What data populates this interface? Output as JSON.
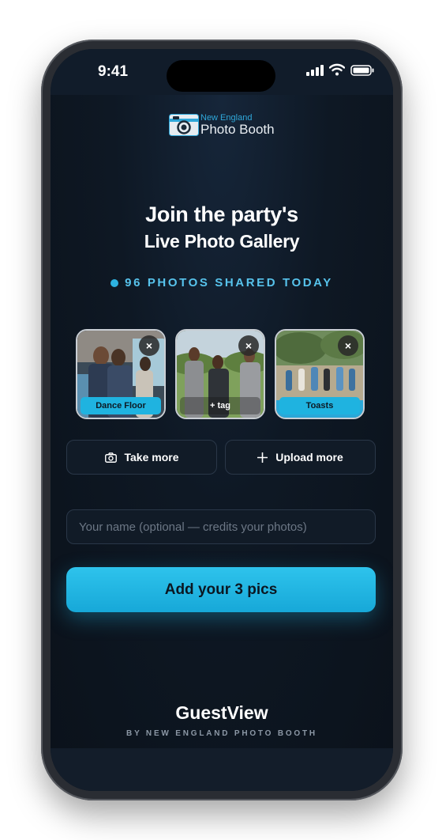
{
  "status_bar": {
    "time": "9:41"
  },
  "logo": {
    "small": "New England",
    "big": "Photo Booth"
  },
  "hero": {
    "title_line1": "Join the party's",
    "title_line2": "Live Photo Gallery"
  },
  "stats": {
    "shared_text": "96 PHOTOS SHARED TODAY"
  },
  "photos": [
    {
      "tag": "Dance Floor",
      "remove": "×"
    },
    {
      "tag": "+ tag",
      "remove": "×"
    },
    {
      "tag": "Toasts",
      "remove": "×"
    }
  ],
  "actions": {
    "take_more": "Take more",
    "upload_more": "Upload more"
  },
  "name_field": {
    "placeholder": "Your name (optional — credits your photos)",
    "value": ""
  },
  "cta": {
    "label": "Add your 3 pics"
  },
  "footer": {
    "brand": "GuestView",
    "sub": "BY NEW ENGLAND PHOTO BOOTH"
  },
  "colors": {
    "accent": "#1fb3e0",
    "background": "#0c1520"
  }
}
